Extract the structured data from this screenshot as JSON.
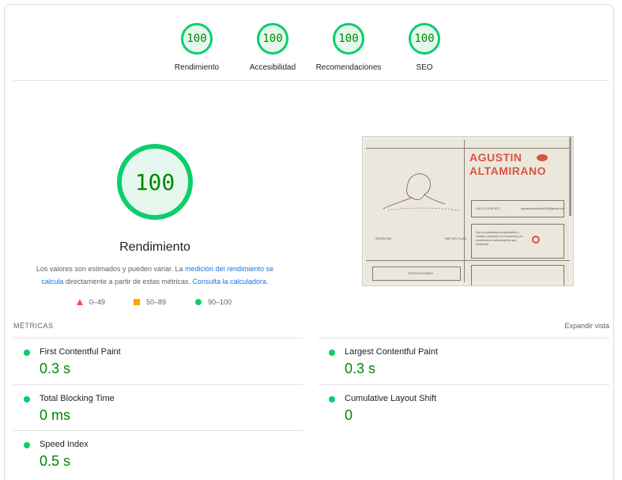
{
  "scores": [
    {
      "label": "Rendimiento",
      "value": "100"
    },
    {
      "label": "Accesibilidad",
      "value": "100"
    },
    {
      "label": "Recomendaciones",
      "value": "100"
    },
    {
      "label": "SEO",
      "value": "100"
    }
  ],
  "main": {
    "score": "100",
    "title": "Rendimiento",
    "desc_prefix": "Los valores son estimados y pueden variar. La ",
    "desc_link1": "medición del rendimiento se calcula",
    "desc_middle": " directamente a partir de estas métricas. ",
    "desc_link2": "Consulta la calculadora",
    "desc_suffix": "."
  },
  "legend": {
    "fail": "0–49",
    "average": "50–89",
    "pass": "90–100"
  },
  "preview": {
    "name_line1": "AGUSTIN",
    "name_line2": "ALTAMIRANO",
    "phone": "+54 9 11 3245 3471",
    "email": "agustinaltamirano2003@gmail.com",
    "country": "ARGENTINA",
    "city": "MAR DEL PLATA",
    "bio": "Soy un profesional comprometido y creativo, dedicado a la innovación y la excelencia en cada proyecto que emprendo.",
    "cert": "CERTIFICACIONES",
    "colors": {
      "accent": "#d9533f",
      "bg": "#ece7dd"
    }
  },
  "metrics": {
    "header": "MÉTRICAS",
    "expand": "Expandir vista",
    "items": [
      {
        "name": "First Contentful Paint",
        "value": "0.3 s"
      },
      {
        "name": "Largest Contentful Paint",
        "value": "0.3 s"
      },
      {
        "name": "Total Blocking Time",
        "value": "0 ms"
      },
      {
        "name": "Cumulative Layout Shift",
        "value": "0"
      },
      {
        "name": "Speed Index",
        "value": "0.5 s"
      }
    ]
  },
  "colors": {
    "pass": "#0cce6b",
    "pass_text": "#008800",
    "average": "#ffa400",
    "fail": "#ff4e42",
    "link": "#1a73e8"
  }
}
